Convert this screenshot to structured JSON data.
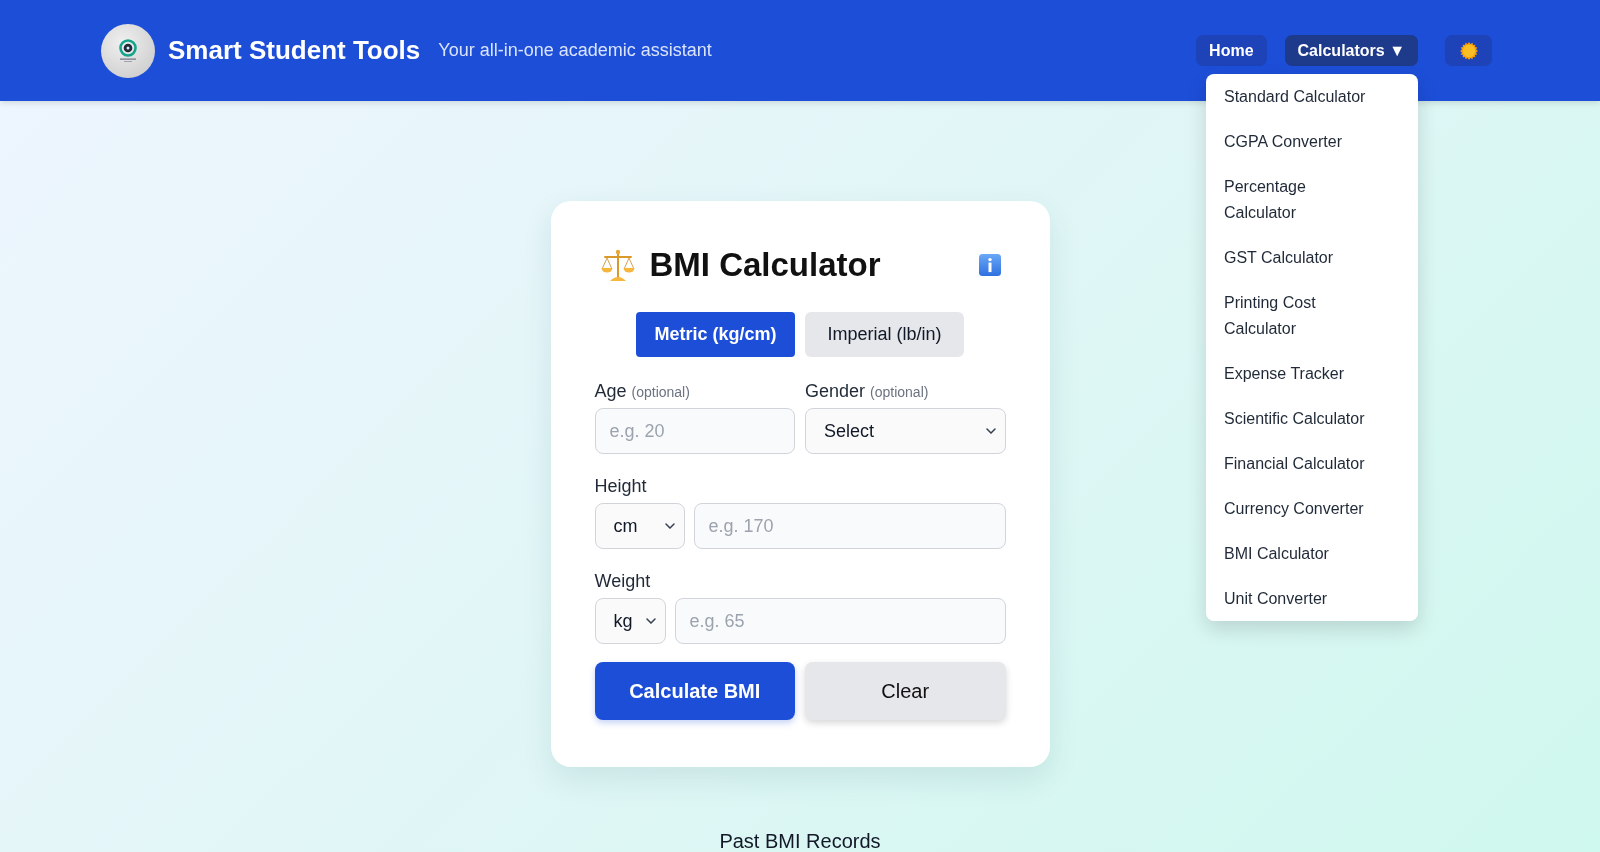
{
  "header": {
    "title": "Smart Student Tools",
    "subtitle": "Your all-in-one academic assistant",
    "nav": {
      "home": {
        "label": "Home"
      },
      "calculators": {
        "label": "Calculators",
        "caret": "▼",
        "expanded": true,
        "menu": [
          "Standard Calculator",
          "CGPA Converter",
          "Percentage Calculator",
          "GST Calculator",
          "Printing Cost Calculator",
          "Expense Tracker",
          "Scientific Calculator",
          "Financial Calculator",
          "Currency Converter",
          "BMI Calculator",
          "Unit Converter"
        ]
      }
    }
  },
  "card": {
    "title": "BMI Calculator",
    "unit_tabs": [
      {
        "label": "Metric (kg/cm)",
        "selected": true
      },
      {
        "label": "Imperial (lb/in)",
        "selected": false
      }
    ],
    "age": {
      "label": "Age",
      "note": "(optional)",
      "placeholder": "e.g. 20"
    },
    "gender": {
      "label": "Gender",
      "note": "(optional)",
      "value": "Select"
    },
    "height": {
      "label": "Height",
      "unit": "cm",
      "placeholder": "e.g. 170"
    },
    "weight": {
      "label": "Weight",
      "unit": "kg",
      "placeholder": "e.g. 65"
    },
    "buttons": [
      {
        "label": "Calculate BMI",
        "kind": "primary"
      },
      {
        "label": "Clear",
        "kind": "secondary"
      }
    ]
  },
  "records": {
    "title": "Past BMI Records"
  }
}
